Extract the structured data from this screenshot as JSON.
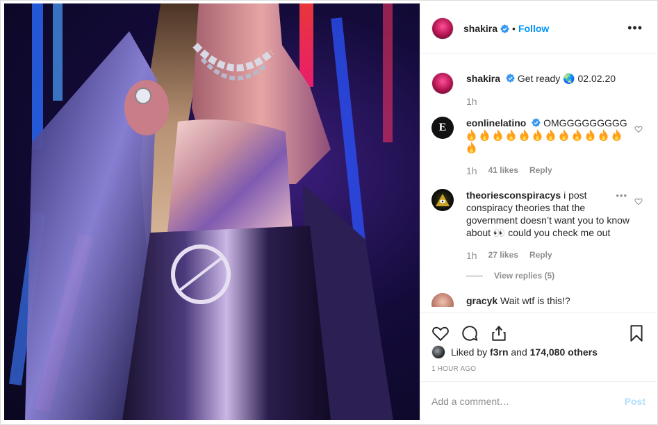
{
  "post": {
    "author": "shakira",
    "follow_label": "Follow",
    "separator": "•",
    "more_label": "•••",
    "caption": {
      "username": "shakira",
      "text": "Get ready 🌏 02.02.20",
      "time": "1h"
    },
    "comments": [
      {
        "username": "eonlinelatino",
        "verified": true,
        "text": "OMGGGGGGGGG",
        "fire_count": 13,
        "time": "1h",
        "likes": "41 likes",
        "reply_label": "Reply"
      },
      {
        "username": "theoriesconspiracys",
        "verified": false,
        "text": "i post conspiracy theories that the government doesn’t want you to know about 👀 could you check me out",
        "time": "1h",
        "likes": "27 likes",
        "reply_label": "Reply",
        "view_replies": "View replies (5)"
      },
      {
        "username": "gracyk",
        "text": "Wait wtf is this!?"
      }
    ],
    "liked_by": {
      "prefix": "Liked by",
      "user": "f3rn",
      "middle": "and",
      "others": "174,080 others"
    },
    "time_ago": "1 HOUR AGO",
    "add_comment_placeholder": "Add a comment…",
    "post_label": "Post"
  },
  "colors": {
    "accent": "#0095f6",
    "post_disabled": "#b2dffc",
    "muted": "#8e8e8e",
    "text": "#262626",
    "fire": "#ff9f1a"
  },
  "icons": [
    "verified-badge-icon",
    "more-options-icon",
    "heart-icon",
    "comment-icon",
    "share-icon",
    "bookmark-icon",
    "fire-emoji-icon"
  ]
}
